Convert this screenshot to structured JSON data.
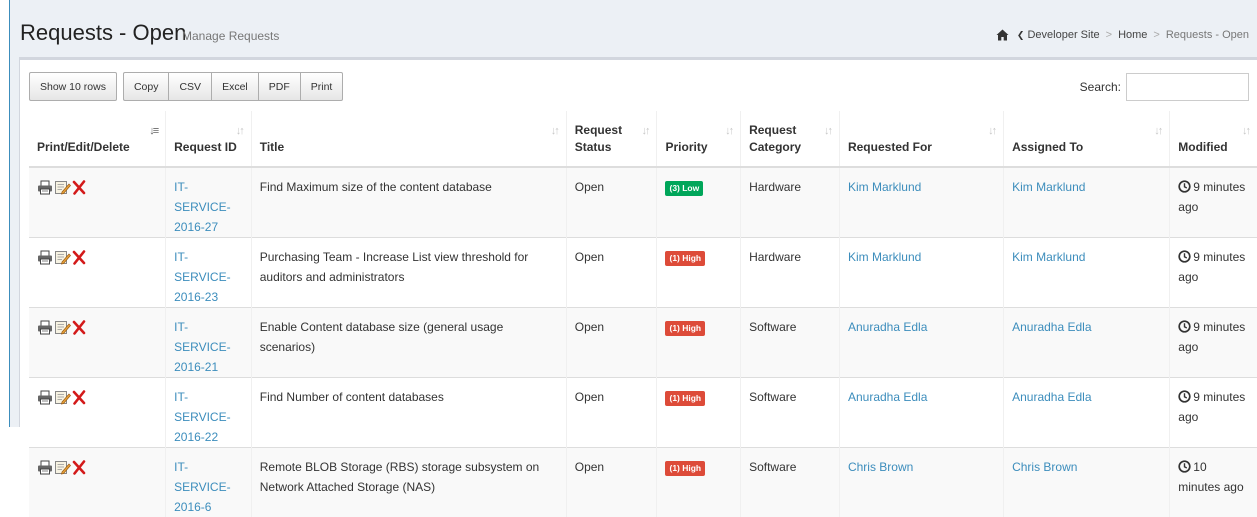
{
  "header": {
    "title": "Requests - Open",
    "subtitle": "Manage Requests",
    "breadcrumb": {
      "back": "Developer Site",
      "home": "Home",
      "current": "Requests - Open"
    }
  },
  "toolbar": {
    "show_rows": "Show 10 rows",
    "copy": "Copy",
    "csv": "CSV",
    "excel": "Excel",
    "pdf": "PDF",
    "print": "Print"
  },
  "search": {
    "label": "Search:",
    "value": ""
  },
  "columns": {
    "actions": "Print/Edit/Delete",
    "request_id": "Request ID",
    "title": "Title",
    "status": "Request Status",
    "priority": "Priority",
    "category": "Request Category",
    "requested_for": "Requested For",
    "assigned_to": "Assigned To",
    "modified": "Modified"
  },
  "rows": [
    {
      "id": "IT-SERVICE-2016-27",
      "title": "Find Maximum size of the content database",
      "status": "Open",
      "priority": "(3) Low",
      "priority_level": "low",
      "category": "Hardware",
      "requested_for": "Kim Marklund",
      "assigned_to": "Kim Marklund",
      "modified": "9 minutes ago"
    },
    {
      "id": "IT-SERVICE-2016-23",
      "title": "Purchasing Team - Increase List view threshold for auditors and administrators",
      "status": "Open",
      "priority": "(1) High",
      "priority_level": "high",
      "category": "Hardware",
      "requested_for": "Kim Marklund",
      "assigned_to": "Kim Marklund",
      "modified": "9 minutes ago"
    },
    {
      "id": "IT-SERVICE-2016-21",
      "title": "Enable Content database size (general usage scenarios)",
      "status": "Open",
      "priority": "(1) High",
      "priority_level": "high",
      "category": "Software",
      "requested_for": "Anuradha Edla",
      "assigned_to": "Anuradha Edla",
      "modified": "9 minutes ago"
    },
    {
      "id": "IT-SERVICE-2016-22",
      "title": "Find Number of content databases",
      "status": "Open",
      "priority": "(1) High",
      "priority_level": "high",
      "category": "Software",
      "requested_for": "Anuradha Edla",
      "assigned_to": "Anuradha Edla",
      "modified": "9 minutes ago"
    },
    {
      "id": "IT-SERVICE-2016-6",
      "title": "Remote BLOB Storage (RBS) storage subsystem on Network Attached Storage (NAS)",
      "status": "Open",
      "priority": "(1) High",
      "priority_level": "high",
      "category": "Software",
      "requested_for": "Chris Brown",
      "assigned_to": "Chris Brown",
      "modified": "10 minutes ago"
    }
  ],
  "colors": {
    "link": "#3c8dbc",
    "high": "#dd4b39",
    "low": "#00a65a"
  }
}
